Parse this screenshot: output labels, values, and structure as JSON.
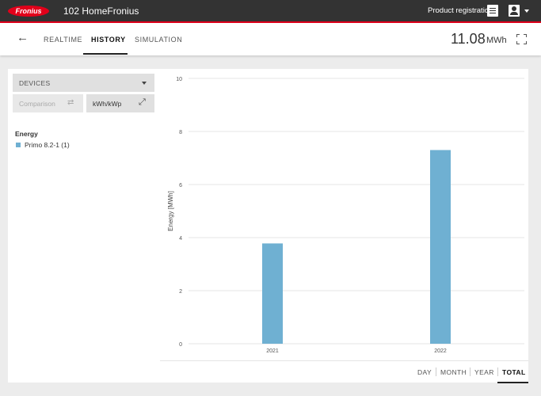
{
  "header": {
    "logo_text": "Fronius",
    "site_name": "102 HomeFronius",
    "product_registration": "Product registration"
  },
  "nav": {
    "tabs": [
      "REALTIME",
      "HISTORY",
      "SIMULATION"
    ],
    "active_tab": "HISTORY",
    "total_value": "11.08",
    "total_unit": "MWh"
  },
  "sidebar": {
    "devices_label": "DEVICES",
    "comparison_label": "Comparison",
    "normalize_label": "kWh/kWp",
    "legend_title": "Energy",
    "legend_items": [
      {
        "label": "Primo 8.2-1 (1)",
        "color": "#6fb0d2"
      }
    ]
  },
  "period_tabs": {
    "items": [
      "DAY",
      "MONTH",
      "YEAR",
      "TOTAL"
    ],
    "active": "TOTAL"
  },
  "chart_data": {
    "type": "bar",
    "categories": [
      "2021",
      "2022"
    ],
    "series": [
      {
        "name": "Primo 8.2-1 (1)",
        "values": [
          3.78,
          7.3
        ],
        "color": "#6fb0d2"
      }
    ],
    "ylabel": "Energy [MWh]",
    "xlabel": "",
    "ylim": [
      0,
      10
    ],
    "yticks": [
      0,
      2,
      4,
      6,
      8,
      10
    ],
    "grid": true
  }
}
